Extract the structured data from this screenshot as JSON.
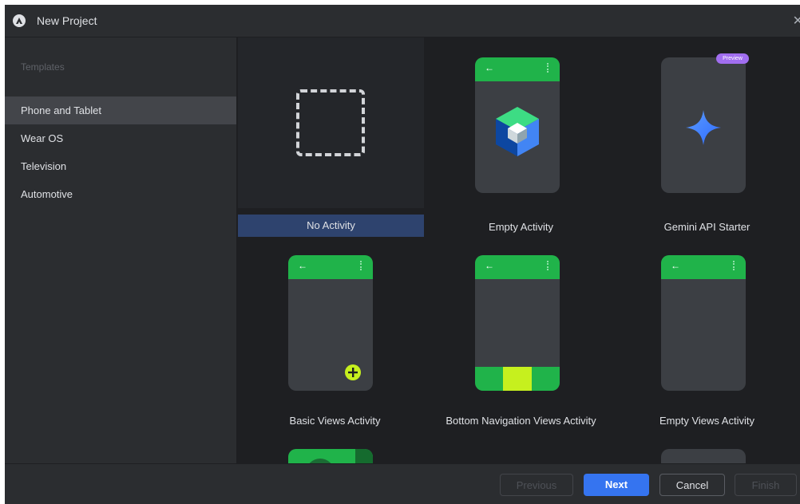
{
  "window": {
    "title": "New Project"
  },
  "sidebar": {
    "header": "Templates",
    "items": [
      {
        "label": "Phone and Tablet",
        "selected": true
      },
      {
        "label": "Wear OS"
      },
      {
        "label": "Television"
      },
      {
        "label": "Automotive"
      }
    ]
  },
  "templates": [
    {
      "label": "No Activity",
      "selected": true
    },
    {
      "label": "Empty Activity"
    },
    {
      "label": "Gemini API Starter",
      "badge": "Preview"
    },
    {
      "label": "Basic Views Activity"
    },
    {
      "label": "Bottom Navigation Views Activity"
    },
    {
      "label": "Empty Views Activity"
    }
  ],
  "footer": {
    "previous": "Previous",
    "next": "Next",
    "cancel": "Cancel",
    "finish": "Finish"
  },
  "colors": {
    "accent": "#3574f0",
    "phone_green": "#20b34a",
    "fab_yellow": "#c6f01e",
    "preview_badge": "#a16ef0",
    "selection": "#2e436e"
  }
}
